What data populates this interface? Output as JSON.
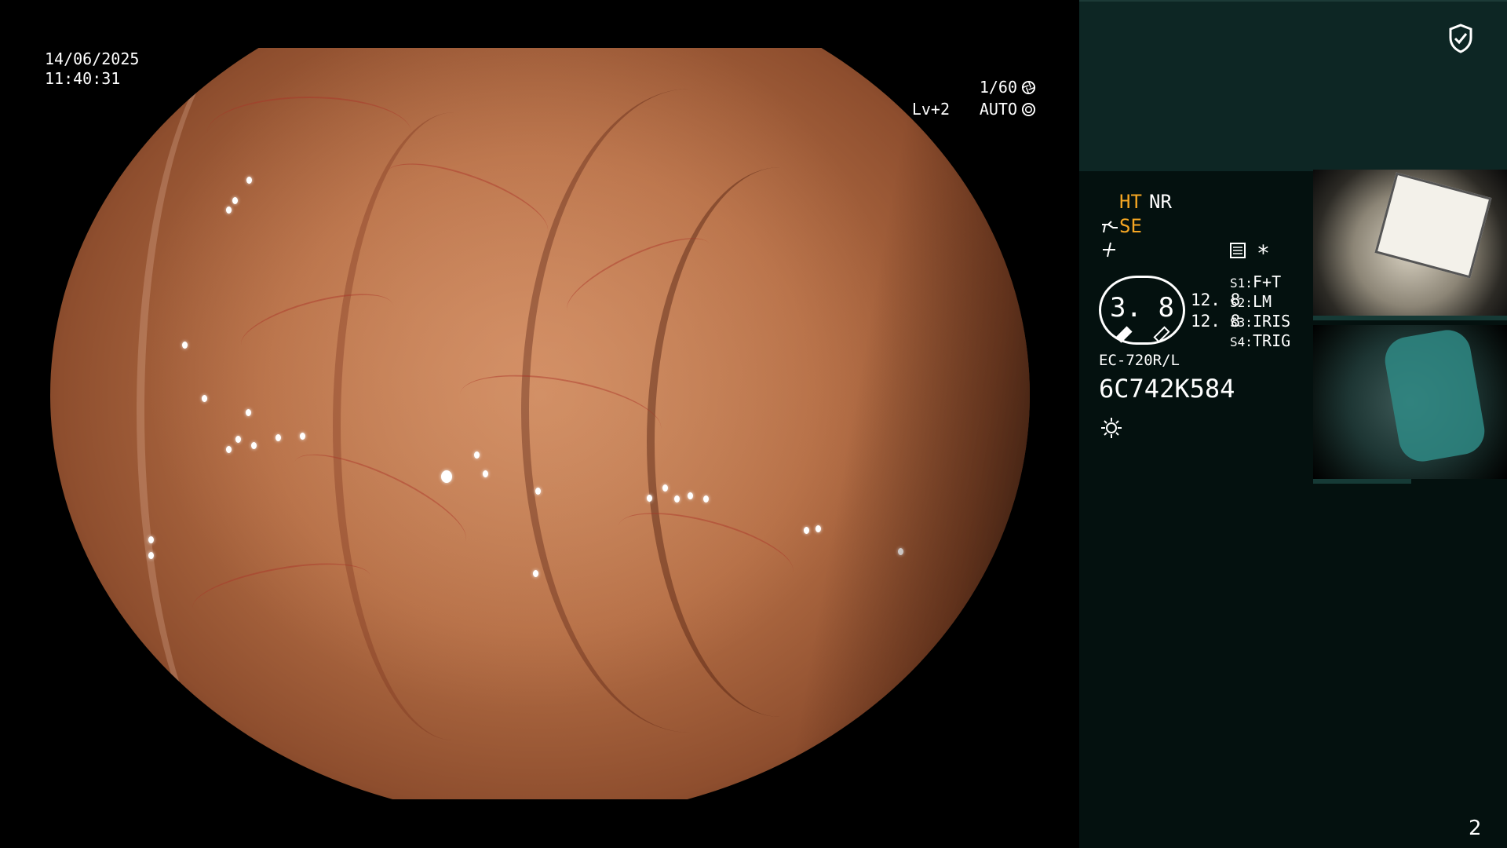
{
  "overlay": {
    "date": "14/06/2025",
    "time": "11:40:31",
    "shutter": "1/60",
    "level": "Lv+2",
    "iris_mode": "AUTO"
  },
  "panel": {
    "mode_ht": "HT",
    "mode_nr": "NR",
    "mode_se": "SE",
    "asterisk": "*",
    "zoom_value": "3. 8",
    "val_top": "12. 8",
    "val_bottom": "12. 8",
    "switches": [
      {
        "key": "S1:",
        "value": "F+T"
      },
      {
        "key": "S2:",
        "value": "LM"
      },
      {
        "key": "S3:",
        "value": "IRIS"
      },
      {
        "key": "S4:",
        "value": "TRIG"
      }
    ],
    "scope_model": "EC-720R/L",
    "serial": "6C742K584",
    "page_number": "2"
  },
  "colors": {
    "amber": "#f5a623",
    "panel_bg": "#04110f",
    "panel_top_bg": "#0d2624"
  },
  "icons": [
    "shield-check-icon",
    "shutter-icon",
    "iris-icon",
    "scope-icon",
    "lightning-icon",
    "settings-icon",
    "light-icon"
  ]
}
